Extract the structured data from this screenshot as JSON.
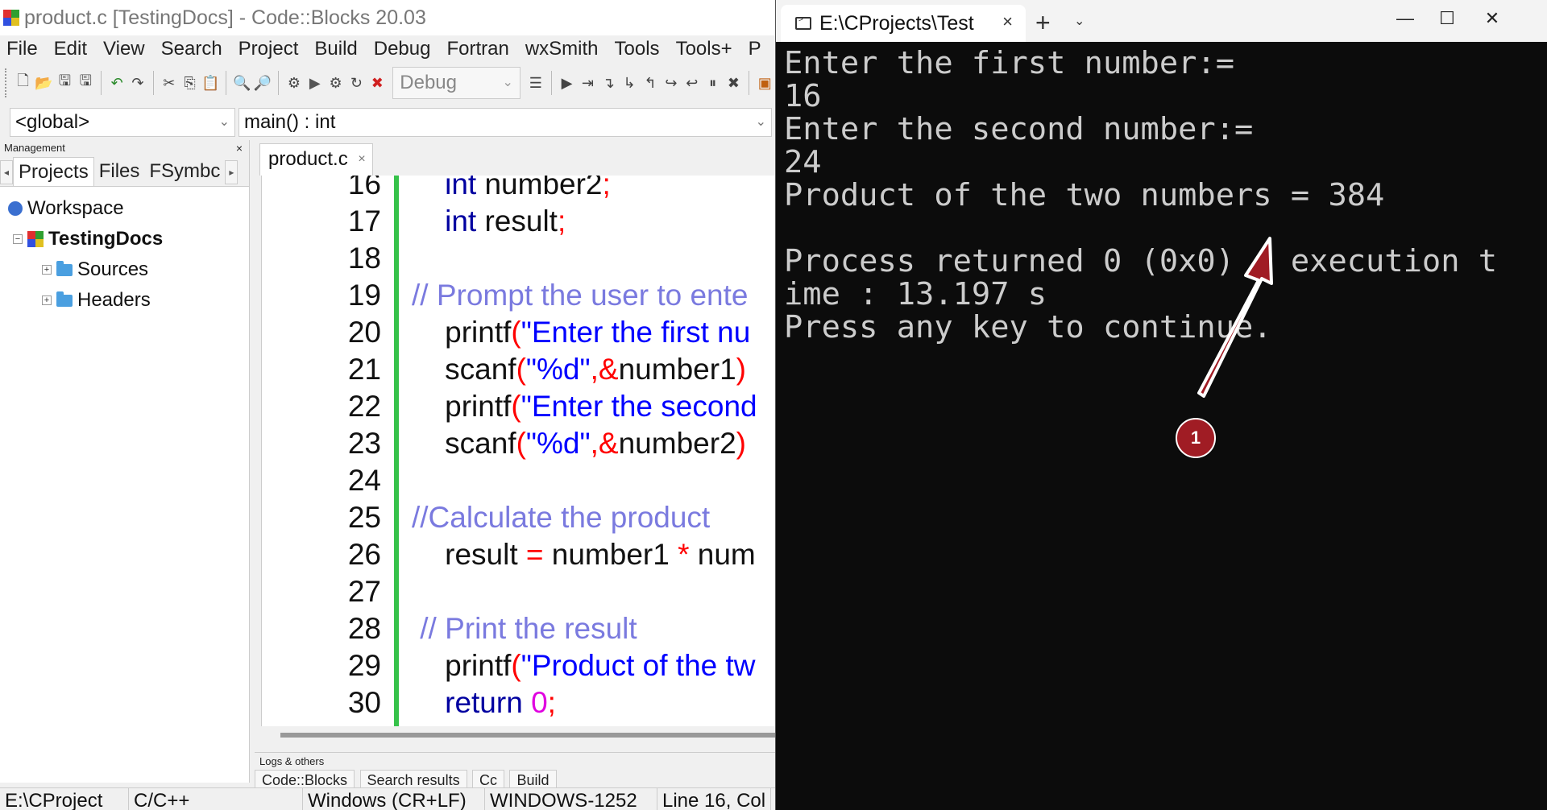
{
  "codeblocks": {
    "window_title": "product.c [TestingDocs] - Code::Blocks 20.03",
    "menu": [
      "File",
      "Edit",
      "View",
      "Search",
      "Project",
      "Build",
      "Debug",
      "Fortran",
      "wxSmith",
      "Tools",
      "Tools+",
      "P"
    ],
    "build_target": "Debug",
    "scope_combo": "<global>",
    "function_combo": "main() : int",
    "management": {
      "header": "Management",
      "close": "×",
      "tabs": [
        "Projects",
        "Files",
        "FSymbc"
      ],
      "tree": {
        "workspace": "Workspace",
        "project": "TestingDocs",
        "folders": [
          "Sources",
          "Headers"
        ]
      }
    },
    "editor": {
      "tab_label": "product.c",
      "tab_close": "×",
      "lines": [
        {
          "n": "16",
          "tokens": [
            {
              "t": "    ",
              "c": ""
            },
            {
              "t": "int",
              "c": "kw"
            },
            {
              "t": " number2",
              "c": ""
            },
            {
              "t": ";",
              "c": "op"
            }
          ]
        },
        {
          "n": "17",
          "tokens": [
            {
              "t": "    ",
              "c": ""
            },
            {
              "t": "int",
              "c": "kw"
            },
            {
              "t": " result",
              "c": ""
            },
            {
              "t": ";",
              "c": "op"
            }
          ]
        },
        {
          "n": "18",
          "tokens": []
        },
        {
          "n": "19",
          "tokens": [
            {
              "t": "// Prompt the user to ente",
              "c": "cm"
            }
          ]
        },
        {
          "n": "20",
          "tokens": [
            {
              "t": "    printf",
              "c": ""
            },
            {
              "t": "(",
              "c": "op"
            },
            {
              "t": "\"Enter the first nu",
              "c": "str"
            }
          ]
        },
        {
          "n": "21",
          "tokens": [
            {
              "t": "    scanf",
              "c": ""
            },
            {
              "t": "(",
              "c": "op"
            },
            {
              "t": "\"%d\"",
              "c": "str"
            },
            {
              "t": ",&",
              "c": "op"
            },
            {
              "t": "number1",
              "c": ""
            },
            {
              "t": ")",
              "c": "op"
            }
          ]
        },
        {
          "n": "22",
          "tokens": [
            {
              "t": "    printf",
              "c": ""
            },
            {
              "t": "(",
              "c": "op"
            },
            {
              "t": "\"Enter the second",
              "c": "str"
            }
          ]
        },
        {
          "n": "23",
          "tokens": [
            {
              "t": "    scanf",
              "c": ""
            },
            {
              "t": "(",
              "c": "op"
            },
            {
              "t": "\"%d\"",
              "c": "str"
            },
            {
              "t": ",&",
              "c": "op"
            },
            {
              "t": "number2",
              "c": ""
            },
            {
              "t": ")",
              "c": "op"
            }
          ]
        },
        {
          "n": "24",
          "tokens": []
        },
        {
          "n": "25",
          "tokens": [
            {
              "t": "//Calculate the product",
              "c": "cm"
            }
          ]
        },
        {
          "n": "26",
          "tokens": [
            {
              "t": "    result ",
              "c": ""
            },
            {
              "t": "=",
              "c": "op"
            },
            {
              "t": " number1 ",
              "c": ""
            },
            {
              "t": "*",
              "c": "op"
            },
            {
              "t": " num",
              "c": ""
            }
          ]
        },
        {
          "n": "27",
          "tokens": []
        },
        {
          "n": "28",
          "tokens": [
            {
              "t": " // Print the result",
              "c": "cm"
            }
          ]
        },
        {
          "n": "29",
          "tokens": [
            {
              "t": "    printf",
              "c": ""
            },
            {
              "t": "(",
              "c": "op"
            },
            {
              "t": "\"Product of the tw",
              "c": "str"
            }
          ]
        },
        {
          "n": "30",
          "tokens": [
            {
              "t": "    ",
              "c": ""
            },
            {
              "t": "return",
              "c": "kw"
            },
            {
              "t": " ",
              "c": ""
            },
            {
              "t": "0",
              "c": "num"
            },
            {
              "t": ";",
              "c": "op"
            }
          ]
        }
      ]
    },
    "logs": {
      "header": "Logs & others",
      "tabs": [
        "Code::Blocks",
        "Search results",
        "Cc",
        "Build"
      ]
    },
    "statusbar": [
      "E:\\CProject",
      "C/C++",
      "Windows (CR+LF)",
      "WINDOWS-1252",
      "Line 16, Col"
    ]
  },
  "terminal": {
    "tab_title": "E:\\CProjects\\Test",
    "tab_close": "×",
    "new_tab": "+",
    "dropdown": "⌄",
    "window_controls": {
      "minimize": "—",
      "maximize": "☐",
      "close": "✕"
    },
    "lines": [
      "Enter the first number:=",
      "16",
      "Enter the second number:=",
      "24",
      "Product of the two numbers = 384",
      "",
      "Process returned 0 (0x0)   execution t",
      "ime : 13.197 s",
      "Press any key to continue."
    ]
  },
  "annotation": {
    "badge": "1",
    "color": "#a01c24"
  }
}
